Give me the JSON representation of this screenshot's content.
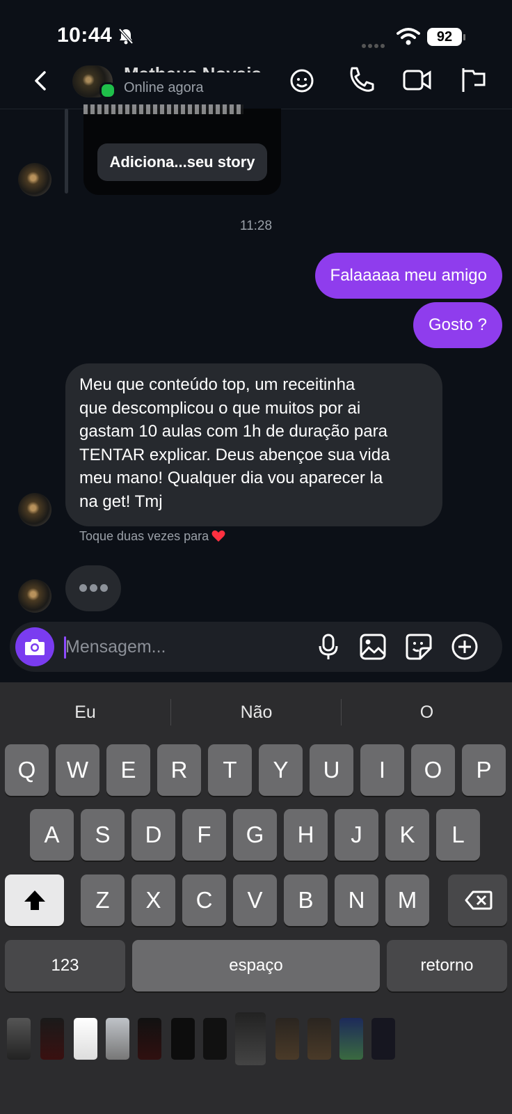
{
  "status_bar": {
    "time": "10:44",
    "battery": "92"
  },
  "header": {
    "contact_name": "Matheus Novais",
    "contact_status": "Online agora"
  },
  "story": {
    "label": "Adiciona...seu story"
  },
  "timestamp": "11:28",
  "messages": {
    "out1": "Falaaaaa meu amigo",
    "out2": "Gosto ?",
    "in1_lines": [
      "Meu que conteúdo top, um receitinha",
      "que descomplicou o que muitos por ai",
      "gastam 10 aulas com 1h de duração para",
      "TENTAR explicar. Deus abençoe sua vida",
      "meu mano! Qualquer dia vou aparecer la",
      "na get! Tmj"
    ],
    "hint": "Toque duas vezes para"
  },
  "composer": {
    "placeholder": "Mensagem..."
  },
  "keyboard": {
    "suggestions": [
      "Eu",
      "Não",
      "O"
    ],
    "row1": [
      "Q",
      "W",
      "E",
      "R",
      "T",
      "Y",
      "U",
      "I",
      "O",
      "P"
    ],
    "row2": [
      "A",
      "S",
      "D",
      "F",
      "G",
      "H",
      "J",
      "K",
      "L"
    ],
    "row3": [
      "Z",
      "X",
      "C",
      "V",
      "B",
      "N",
      "M"
    ],
    "numbers_key": "123",
    "space_key": "espaço",
    "return_key": "retorno"
  },
  "icons": {
    "back": "chevron-left-icon",
    "header": [
      "sticker-face-icon",
      "phone-icon",
      "video-icon",
      "flag-icon"
    ],
    "composer": [
      "camera-icon",
      "microphone-icon",
      "image-icon",
      "sticker-icon",
      "plus-circle-icon"
    ]
  },
  "colors": {
    "outgoing_bubble": "#8f3ded",
    "incoming_bubble": "#26292e",
    "camera_button": "#7a3cf0",
    "online": "#1fbf4a"
  }
}
